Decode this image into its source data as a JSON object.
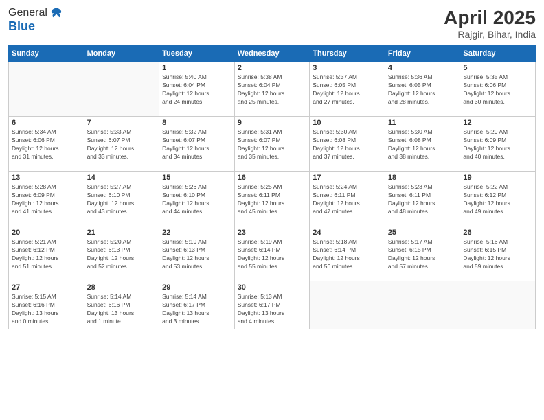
{
  "header": {
    "logo_line1": "General",
    "logo_line2": "Blue",
    "month": "April 2025",
    "location": "Rajgir, Bihar, India"
  },
  "weekdays": [
    "Sunday",
    "Monday",
    "Tuesday",
    "Wednesday",
    "Thursday",
    "Friday",
    "Saturday"
  ],
  "weeks": [
    [
      {
        "day": "",
        "info": ""
      },
      {
        "day": "",
        "info": ""
      },
      {
        "day": "1",
        "info": "Sunrise: 5:40 AM\nSunset: 6:04 PM\nDaylight: 12 hours\nand 24 minutes."
      },
      {
        "day": "2",
        "info": "Sunrise: 5:38 AM\nSunset: 6:04 PM\nDaylight: 12 hours\nand 25 minutes."
      },
      {
        "day": "3",
        "info": "Sunrise: 5:37 AM\nSunset: 6:05 PM\nDaylight: 12 hours\nand 27 minutes."
      },
      {
        "day": "4",
        "info": "Sunrise: 5:36 AM\nSunset: 6:05 PM\nDaylight: 12 hours\nand 28 minutes."
      },
      {
        "day": "5",
        "info": "Sunrise: 5:35 AM\nSunset: 6:06 PM\nDaylight: 12 hours\nand 30 minutes."
      }
    ],
    [
      {
        "day": "6",
        "info": "Sunrise: 5:34 AM\nSunset: 6:06 PM\nDaylight: 12 hours\nand 31 minutes."
      },
      {
        "day": "7",
        "info": "Sunrise: 5:33 AM\nSunset: 6:07 PM\nDaylight: 12 hours\nand 33 minutes."
      },
      {
        "day": "8",
        "info": "Sunrise: 5:32 AM\nSunset: 6:07 PM\nDaylight: 12 hours\nand 34 minutes."
      },
      {
        "day": "9",
        "info": "Sunrise: 5:31 AM\nSunset: 6:07 PM\nDaylight: 12 hours\nand 35 minutes."
      },
      {
        "day": "10",
        "info": "Sunrise: 5:30 AM\nSunset: 6:08 PM\nDaylight: 12 hours\nand 37 minutes."
      },
      {
        "day": "11",
        "info": "Sunrise: 5:30 AM\nSunset: 6:08 PM\nDaylight: 12 hours\nand 38 minutes."
      },
      {
        "day": "12",
        "info": "Sunrise: 5:29 AM\nSunset: 6:09 PM\nDaylight: 12 hours\nand 40 minutes."
      }
    ],
    [
      {
        "day": "13",
        "info": "Sunrise: 5:28 AM\nSunset: 6:09 PM\nDaylight: 12 hours\nand 41 minutes."
      },
      {
        "day": "14",
        "info": "Sunrise: 5:27 AM\nSunset: 6:10 PM\nDaylight: 12 hours\nand 43 minutes."
      },
      {
        "day": "15",
        "info": "Sunrise: 5:26 AM\nSunset: 6:10 PM\nDaylight: 12 hours\nand 44 minutes."
      },
      {
        "day": "16",
        "info": "Sunrise: 5:25 AM\nSunset: 6:11 PM\nDaylight: 12 hours\nand 45 minutes."
      },
      {
        "day": "17",
        "info": "Sunrise: 5:24 AM\nSunset: 6:11 PM\nDaylight: 12 hours\nand 47 minutes."
      },
      {
        "day": "18",
        "info": "Sunrise: 5:23 AM\nSunset: 6:11 PM\nDaylight: 12 hours\nand 48 minutes."
      },
      {
        "day": "19",
        "info": "Sunrise: 5:22 AM\nSunset: 6:12 PM\nDaylight: 12 hours\nand 49 minutes."
      }
    ],
    [
      {
        "day": "20",
        "info": "Sunrise: 5:21 AM\nSunset: 6:12 PM\nDaylight: 12 hours\nand 51 minutes."
      },
      {
        "day": "21",
        "info": "Sunrise: 5:20 AM\nSunset: 6:13 PM\nDaylight: 12 hours\nand 52 minutes."
      },
      {
        "day": "22",
        "info": "Sunrise: 5:19 AM\nSunset: 6:13 PM\nDaylight: 12 hours\nand 53 minutes."
      },
      {
        "day": "23",
        "info": "Sunrise: 5:19 AM\nSunset: 6:14 PM\nDaylight: 12 hours\nand 55 minutes."
      },
      {
        "day": "24",
        "info": "Sunrise: 5:18 AM\nSunset: 6:14 PM\nDaylight: 12 hours\nand 56 minutes."
      },
      {
        "day": "25",
        "info": "Sunrise: 5:17 AM\nSunset: 6:15 PM\nDaylight: 12 hours\nand 57 minutes."
      },
      {
        "day": "26",
        "info": "Sunrise: 5:16 AM\nSunset: 6:15 PM\nDaylight: 12 hours\nand 59 minutes."
      }
    ],
    [
      {
        "day": "27",
        "info": "Sunrise: 5:15 AM\nSunset: 6:16 PM\nDaylight: 13 hours\nand 0 minutes."
      },
      {
        "day": "28",
        "info": "Sunrise: 5:14 AM\nSunset: 6:16 PM\nDaylight: 13 hours\nand 1 minute."
      },
      {
        "day": "29",
        "info": "Sunrise: 5:14 AM\nSunset: 6:17 PM\nDaylight: 13 hours\nand 3 minutes."
      },
      {
        "day": "30",
        "info": "Sunrise: 5:13 AM\nSunset: 6:17 PM\nDaylight: 13 hours\nand 4 minutes."
      },
      {
        "day": "",
        "info": ""
      },
      {
        "day": "",
        "info": ""
      },
      {
        "day": "",
        "info": ""
      }
    ]
  ]
}
